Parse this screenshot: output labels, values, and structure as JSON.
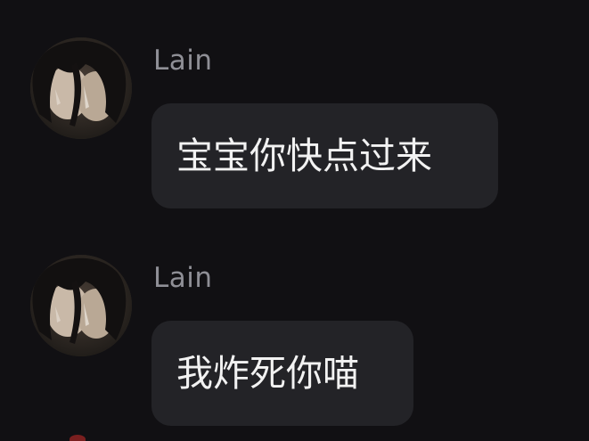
{
  "messages": [
    {
      "sender": "Lain",
      "text": "宝宝你快点过来",
      "avatar_icon": "user-avatar"
    },
    {
      "sender": "Lain",
      "text": "我炸死你喵",
      "avatar_icon": "user-avatar"
    }
  ],
  "colors": {
    "background": "#111013",
    "bubble": "#232327",
    "sender_name": "#8f8f96",
    "message_text": "#f2f2f2"
  }
}
